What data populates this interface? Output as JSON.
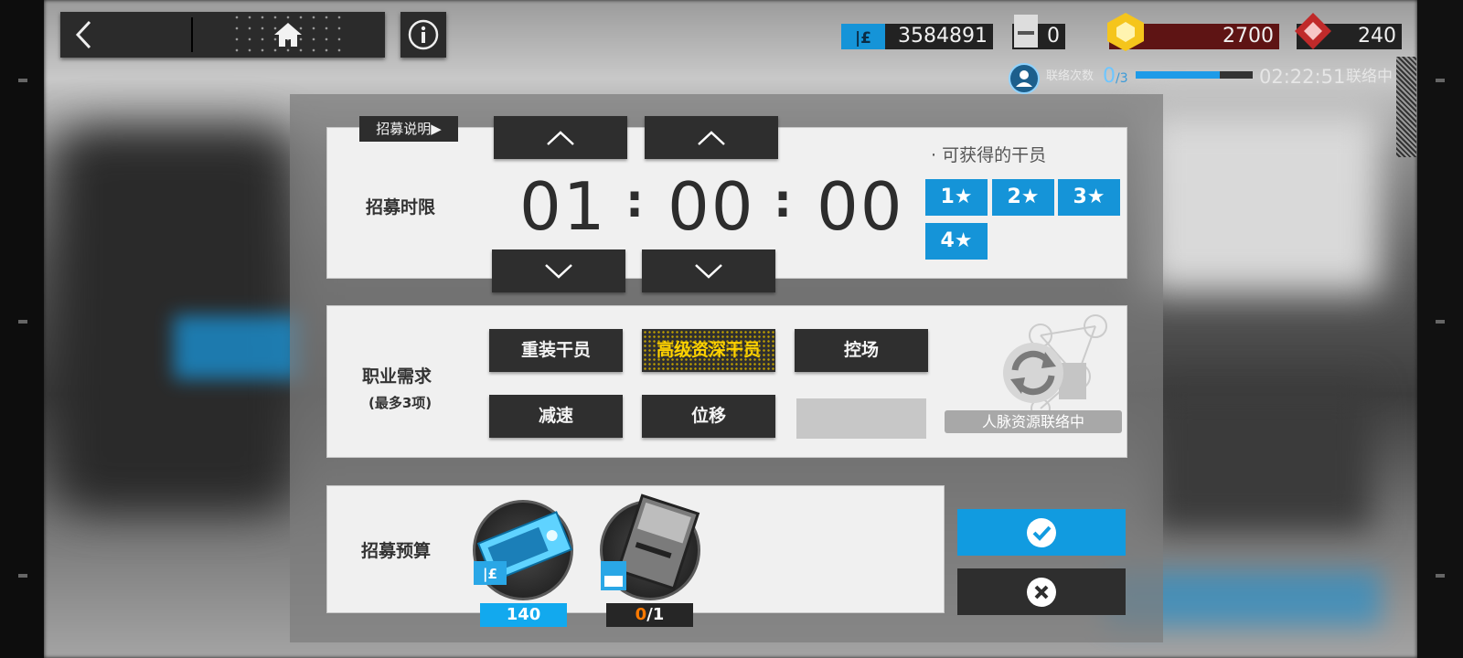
{
  "header": {
    "resources": [
      {
        "name": "lmd",
        "value": "3584891",
        "icon": "lmd-icon"
      },
      {
        "name": "recruit-permit",
        "value": "0",
        "icon": "permit-icon"
      },
      {
        "name": "orundum",
        "value": "2700",
        "icon": "orundum-icon"
      },
      {
        "name": "originite-prime",
        "value": "240",
        "icon": "originite-icon"
      }
    ],
    "contact": {
      "label": "联络次数",
      "current": "0",
      "total": "/3",
      "progress": 0.72,
      "timer": "02:22:51",
      "status": "联络中"
    }
  },
  "recruit": {
    "explain_label": "招募说明▶",
    "time_label": "招募时限",
    "hours": "01",
    "minutes": "00",
    "seconds": "00",
    "available_title": "· 可获得的干员",
    "stars": [
      "1★",
      "2★",
      "3★",
      "4★"
    ],
    "class_label": "职业需求",
    "class_sub": "(最多3项)",
    "tags": [
      {
        "label": "重装干员",
        "selected": false
      },
      {
        "label": "高级资深干员",
        "selected": true
      },
      {
        "label": "控场",
        "selected": false
      },
      {
        "label": "减速",
        "selected": false
      },
      {
        "label": "位移",
        "selected": false
      },
      {
        "label": "",
        "selected": false
      }
    ],
    "hr_status": "人脉资源联络中",
    "budget_label": "招募预算",
    "lmd_cost": "140",
    "permit_have": "0",
    "permit_need": "/1"
  },
  "colors": {
    "accent": "#1594d8",
    "selected_tag": "#ffd200",
    "panel": "#f0f0f0",
    "dark_button": "#2e2e2e"
  }
}
